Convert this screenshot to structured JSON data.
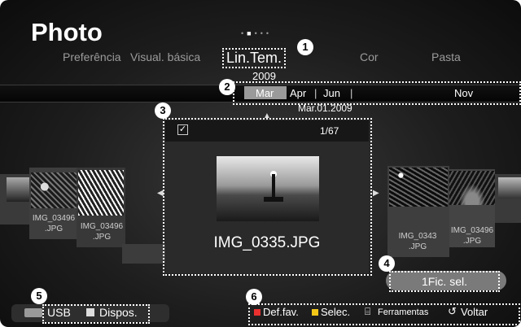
{
  "header": {
    "title": "Photo"
  },
  "tabs": [
    "Preferência",
    "Visual. básica",
    "Lin.Tem.",
    "Cor",
    "Pasta"
  ],
  "timeline": {
    "year": "2009",
    "months": [
      "Mar",
      "Apr",
      "Jun",
      "Nov"
    ],
    "selected_month": "Mar",
    "current_date": "Mar.01.2009"
  },
  "thumbnails": {
    "left": [
      "IMG_03496 .JPG",
      "IMG_03496 .JPG"
    ],
    "right": [
      "IMG_0343 .JPG",
      "IMG_03496 .JPG"
    ]
  },
  "main_photo": {
    "counter": "1/67",
    "filename": "IMG_0335.JPG"
  },
  "selection": {
    "label": "1Fic. sel."
  },
  "source": {
    "usb": "USB",
    "device": "Dispos."
  },
  "footer": {
    "fav": "Def.fav.",
    "select": "Selec.",
    "tools": "Ferramentas",
    "back": "Voltar"
  },
  "callouts": [
    "1",
    "2",
    "3",
    "4",
    "5",
    "6"
  ],
  "colors": {
    "fav_key": "#e8302f",
    "select_key": "#f2c617"
  }
}
